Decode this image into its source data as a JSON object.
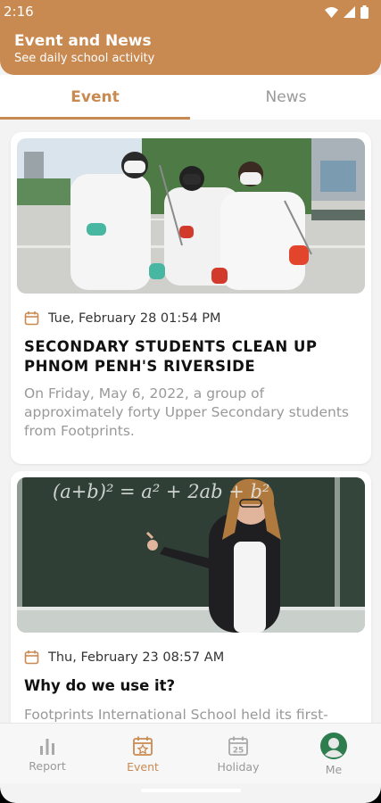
{
  "status_bar": {
    "time": "2:16"
  },
  "header": {
    "title": "Event and News",
    "subtitle": "See daily school activity"
  },
  "tabs": [
    {
      "label": "Event",
      "selected": true
    },
    {
      "label": "News",
      "selected": false
    }
  ],
  "events": [
    {
      "date": "Tue, February 28 01:54 PM",
      "title": "SECONDARY STUDENTS CLEAN UP PHNOM PENH'S RIVERSIDE",
      "description": "On Friday, May 6, 2022, a group of approximately forty Upper Secondary students from Footprints.",
      "image": "students-cleaning-riverside-photo"
    },
    {
      "date": "Thu, February 23 08:57 AM",
      "title": "Why do we use it?",
      "description": "Footprints International School held its first-",
      "image": "teacher-at-chalkboard-photo",
      "chalk_text": "(a+b)² = a² + 2ab + b²"
    }
  ],
  "bottom_nav": [
    {
      "label": "Report",
      "icon": "bar-chart-icon",
      "active": false
    },
    {
      "label": "Event",
      "icon": "event-star-icon",
      "active": true
    },
    {
      "label": "Holiday",
      "icon": "calendar-25-icon",
      "active": false
    },
    {
      "label": "Me",
      "icon": "avatar-icon",
      "active": false
    }
  ],
  "colors": {
    "accent": "#c98a52",
    "muted": "#999999",
    "background": "#f3f3f3",
    "avatar": "#2e7d4f"
  }
}
